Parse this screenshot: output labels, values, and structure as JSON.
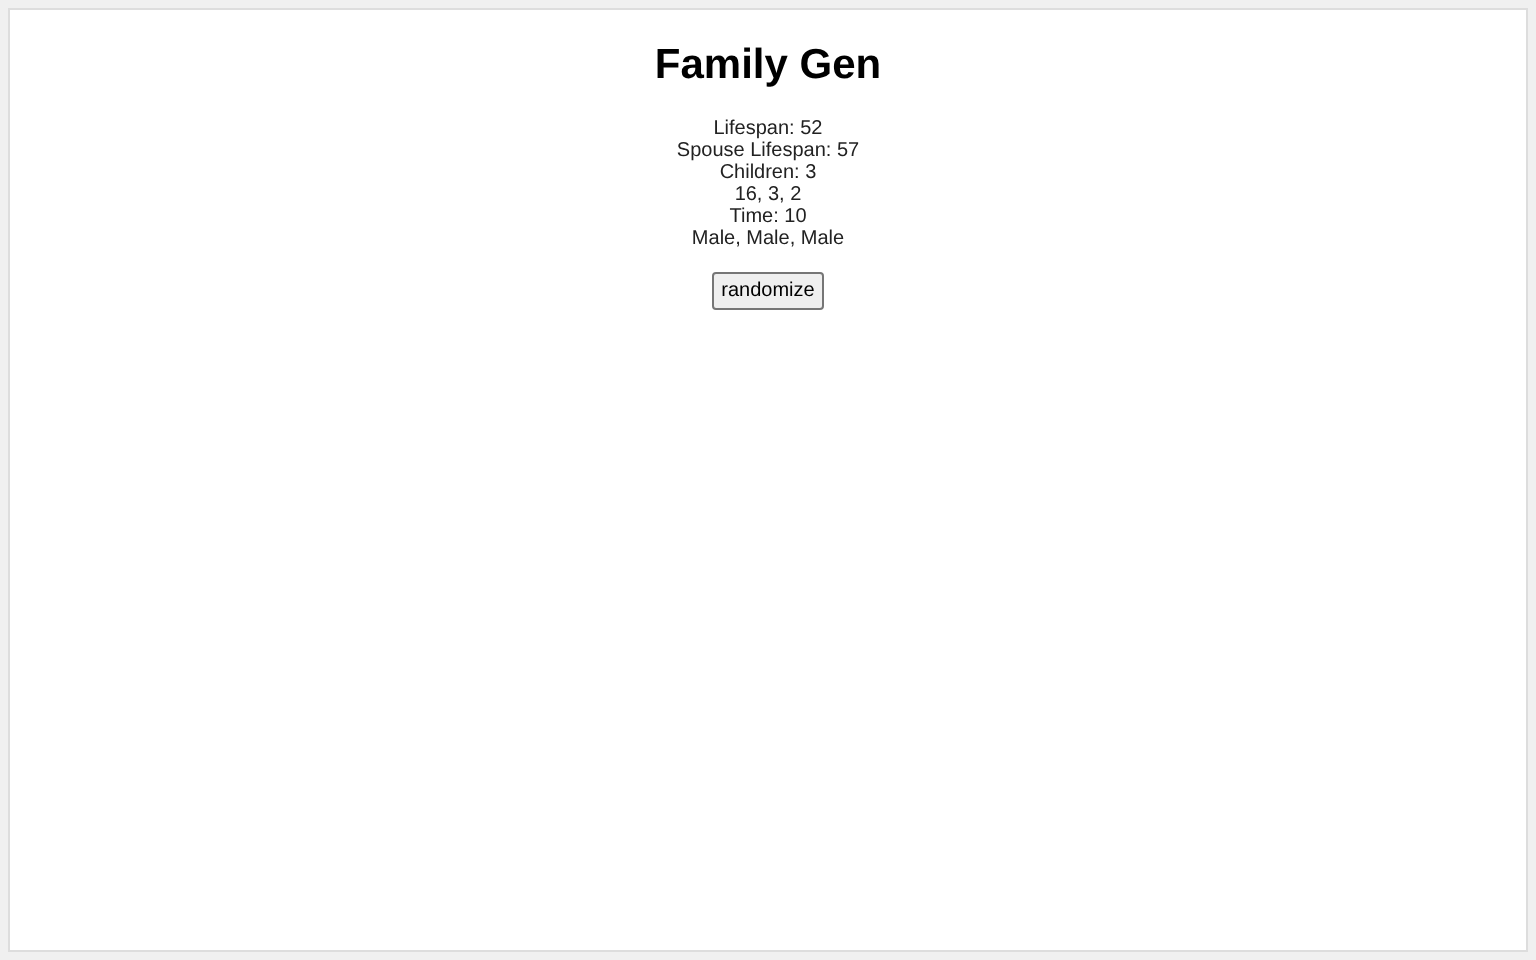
{
  "title": "Family Gen",
  "lines": [
    "Lifespan: 52",
    "Spouse Lifespan: 57",
    "Children: 3",
    "16, 3, 2",
    "Time: 10",
    "Male, Male, Male"
  ],
  "button": "randomize"
}
